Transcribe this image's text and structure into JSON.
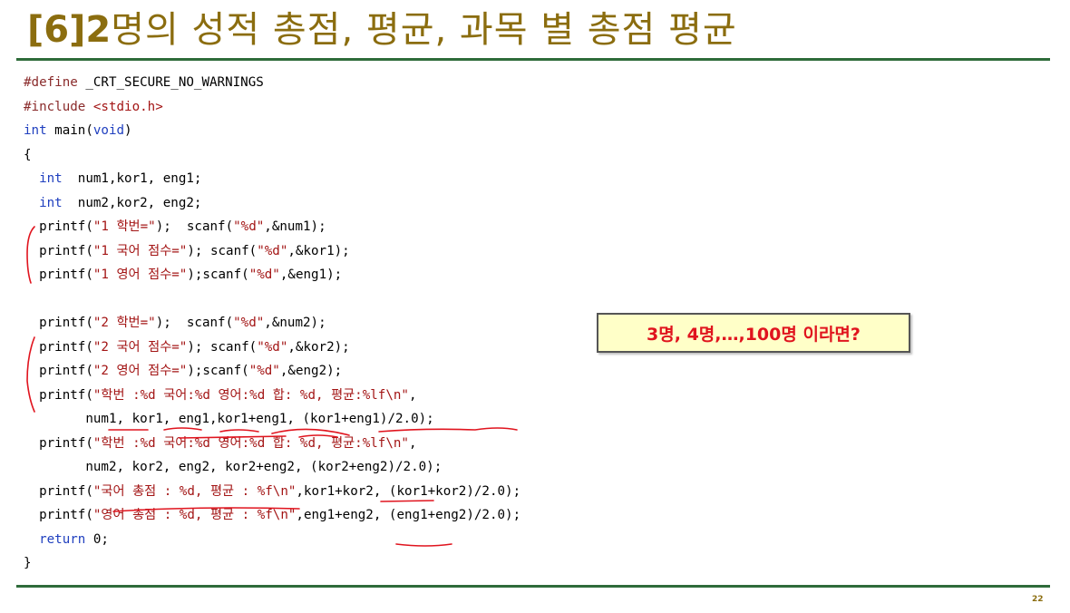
{
  "slide": {
    "title_prefix": "[6]2",
    "title_main": "명의 성적 총점, 평균, 과목 별 총점 평균",
    "callout": "3명, 4명,…,100명 이라면?",
    "page_number": "22"
  },
  "code_lines": [
    [
      {
        "t": "#define ",
        "c": "p"
      },
      {
        "t": "_CRT_SECURE_NO_WARNINGS",
        "c": ""
      }
    ],
    [
      {
        "t": "#include ",
        "c": "p"
      },
      {
        "t": "<stdio.h>",
        "c": "s"
      }
    ],
    [
      {
        "t": "int",
        "c": "k"
      },
      {
        "t": " main(",
        "c": ""
      },
      {
        "t": "void",
        "c": "k"
      },
      {
        "t": ")",
        "c": ""
      }
    ],
    [
      {
        "t": "{",
        "c": ""
      }
    ],
    [
      {
        "t": "  ",
        "c": ""
      },
      {
        "t": "int",
        "c": "k"
      },
      {
        "t": "  num1,kor1, eng1;",
        "c": ""
      }
    ],
    [
      {
        "t": "  ",
        "c": ""
      },
      {
        "t": "int",
        "c": "k"
      },
      {
        "t": "  num2,kor2, eng2;",
        "c": ""
      }
    ],
    [
      {
        "t": "  printf(",
        "c": ""
      },
      {
        "t": "\"1 학번=\"",
        "c": "s"
      },
      {
        "t": ");  scanf(",
        "c": ""
      },
      {
        "t": "\"%d\"",
        "c": "s"
      },
      {
        "t": ",&num1);",
        "c": ""
      }
    ],
    [
      {
        "t": "  printf(",
        "c": ""
      },
      {
        "t": "\"1 국어 점수=\"",
        "c": "s"
      },
      {
        "t": "); scanf(",
        "c": ""
      },
      {
        "t": "\"%d\"",
        "c": "s"
      },
      {
        "t": ",&kor1);",
        "c": ""
      }
    ],
    [
      {
        "t": "  printf(",
        "c": ""
      },
      {
        "t": "\"1 영어 점수=\"",
        "c": "s"
      },
      {
        "t": ");scanf(",
        "c": ""
      },
      {
        "t": "\"%d\"",
        "c": "s"
      },
      {
        "t": ",&eng1);",
        "c": ""
      }
    ],
    [
      {
        "t": "",
        "c": ""
      }
    ],
    [
      {
        "t": "  printf(",
        "c": ""
      },
      {
        "t": "\"2 학번=\"",
        "c": "s"
      },
      {
        "t": ");  scanf(",
        "c": ""
      },
      {
        "t": "\"%d\"",
        "c": "s"
      },
      {
        "t": ",&num2);",
        "c": ""
      }
    ],
    [
      {
        "t": "  printf(",
        "c": ""
      },
      {
        "t": "\"2 국어 점수=\"",
        "c": "s"
      },
      {
        "t": "); scanf(",
        "c": ""
      },
      {
        "t": "\"%d\"",
        "c": "s"
      },
      {
        "t": ",&kor2);",
        "c": ""
      }
    ],
    [
      {
        "t": "  printf(",
        "c": ""
      },
      {
        "t": "\"2 영어 점수=\"",
        "c": "s"
      },
      {
        "t": ");scanf(",
        "c": ""
      },
      {
        "t": "\"%d\"",
        "c": "s"
      },
      {
        "t": ",&eng2);",
        "c": ""
      }
    ],
    [
      {
        "t": "  printf(",
        "c": ""
      },
      {
        "t": "\"학번 :%d 국어:%d 영어:%d 합: %d, 평균:%lf\\n\"",
        "c": "s"
      },
      {
        "t": ",",
        "c": ""
      }
    ],
    [
      {
        "t": "        num1, kor1, eng1,kor1+eng1, (kor1+eng1)/2.0);",
        "c": ""
      }
    ],
    [
      {
        "t": "  printf(",
        "c": ""
      },
      {
        "t": "\"학번 :%d 국어:%d 영어:%d 합: %d, 평균:%lf\\n\"",
        "c": "s"
      },
      {
        "t": ",",
        "c": ""
      }
    ],
    [
      {
        "t": "        num2, kor2, eng2, kor2+eng2, (kor2+eng2)/2.0);",
        "c": ""
      }
    ],
    [
      {
        "t": "  printf(",
        "c": ""
      },
      {
        "t": "\"국어 총점 : %d, 평균 : %f\\n\"",
        "c": "s"
      },
      {
        "t": ",kor1+kor2, (kor1+kor2)/2.0);",
        "c": ""
      }
    ],
    [
      {
        "t": "  printf(",
        "c": ""
      },
      {
        "t": "\"영어 총점 : %d, 평균 : %f\\n\"",
        "c": "s"
      },
      {
        "t": ",eng1+eng2, (eng1+eng2)/2.0);",
        "c": ""
      }
    ],
    [
      {
        "t": "  ",
        "c": ""
      },
      {
        "t": "return",
        "c": "k"
      },
      {
        "t": " 0;",
        "c": ""
      }
    ],
    [
      {
        "t": "}",
        "c": ""
      }
    ]
  ],
  "colors": {
    "title": "#8b6d0f",
    "rule": "#2e6b3a",
    "keyword": "#1f3fbf",
    "string": "#a31515",
    "callout_text": "#e0141e",
    "callout_bg": "#ffffc8",
    "annotation": "#e0141e"
  }
}
